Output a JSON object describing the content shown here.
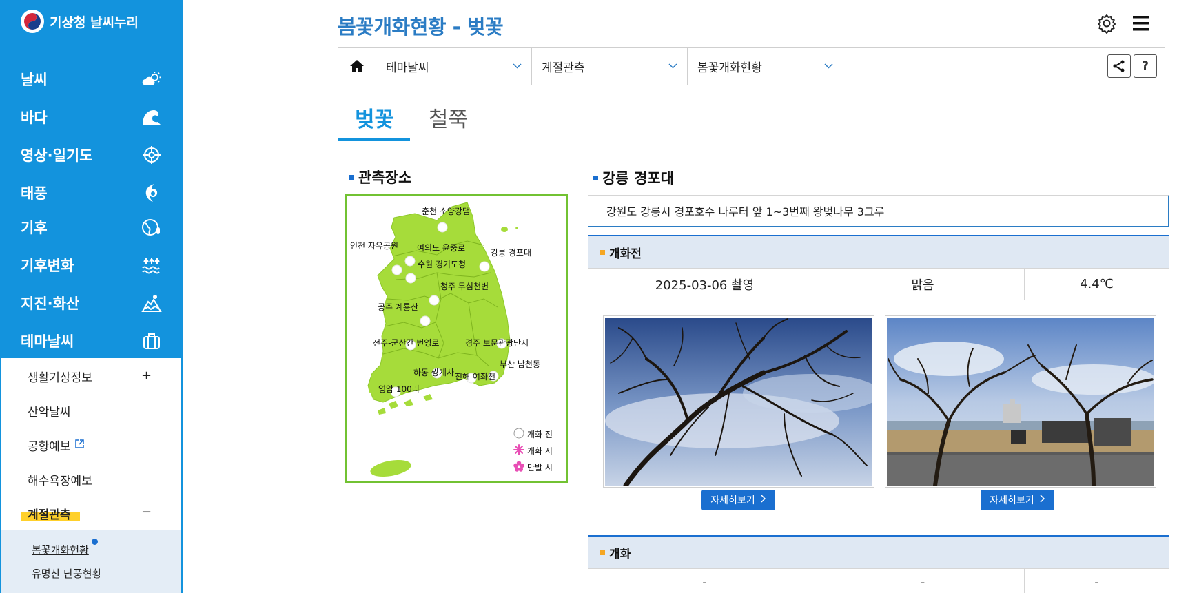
{
  "brand": {
    "name": "기상청 날씨누리"
  },
  "sidebar": {
    "items": [
      {
        "label": "날씨",
        "icon": "weather-sun-cloud-icon"
      },
      {
        "label": "바다",
        "icon": "sea-wave-icon"
      },
      {
        "label": "영상·일기도",
        "icon": "satellite-crosshair-icon"
      },
      {
        "label": "태풍",
        "icon": "typhoon-icon"
      },
      {
        "label": "기후",
        "icon": "climate-globe-icon"
      },
      {
        "label": "기후변화",
        "icon": "climate-change-icon"
      },
      {
        "label": "지진·화산",
        "icon": "earthquake-volcano-icon"
      },
      {
        "label": "테마날씨",
        "icon": "suitcase-icon"
      }
    ],
    "submenu": [
      {
        "label": "생활기상정보",
        "toggle": "+"
      },
      {
        "label": "산악날씨"
      },
      {
        "label": "공항예보",
        "external": true
      },
      {
        "label": "해수욕장예보"
      },
      {
        "label": "계절관측",
        "toggle": "−",
        "active": true
      }
    ],
    "subsubmenu": [
      {
        "label": "봄꽃개화현황",
        "active": true
      },
      {
        "label": "유명산 단풍현황"
      }
    ]
  },
  "header": {
    "title": "봄꽃개화현황 - 벚꽃"
  },
  "breadcrumb": [
    "테마날씨",
    "계절관측",
    "봄꽃개화현황"
  ],
  "tools": {
    "help_label": "?"
  },
  "tabs": [
    {
      "label": "벚꽃",
      "active": true
    },
    {
      "label": "철쭉",
      "active": false
    }
  ],
  "map_section": {
    "title": "관측장소",
    "stations": [
      "춘천 소양강댐",
      "인천 자유공원",
      "여의도 윤중로",
      "수원 경기도청",
      "강릉 경포대",
      "청주 무심천변",
      "공주 계룡산",
      "전주-군산간 번영로",
      "경주 보문관광단지",
      "부산 남천동",
      "하동 쌍계사",
      "진해 여좌천",
      "영암 100리"
    ],
    "legend": [
      {
        "label": "개화 전",
        "icon": "circle-icon"
      },
      {
        "label": "개화 시",
        "icon": "blossom-open-icon",
        "color": "#e84fb5"
      },
      {
        "label": "만발 시",
        "icon": "blossom-full-icon",
        "color": "#e84fb5"
      }
    ]
  },
  "detail": {
    "station_name": "강릉 경포대",
    "description": "강원도 강릉시 경포호수 나루터 앞 1~3번째 왕벚나무 3그루",
    "before": {
      "heading": "개화전",
      "date": "2025-03-06 촬영",
      "weather": "맑음",
      "temp": "4.4℃",
      "button_label": "자세히보기"
    },
    "bloom": {
      "heading": "개화",
      "date": "-",
      "weather": "-",
      "temp": "-"
    }
  },
  "colors": {
    "sidebar": "#1393dd",
    "accent": "#1a6fd0",
    "map_land": "#a6dc3a",
    "map_border": "#72c232"
  }
}
